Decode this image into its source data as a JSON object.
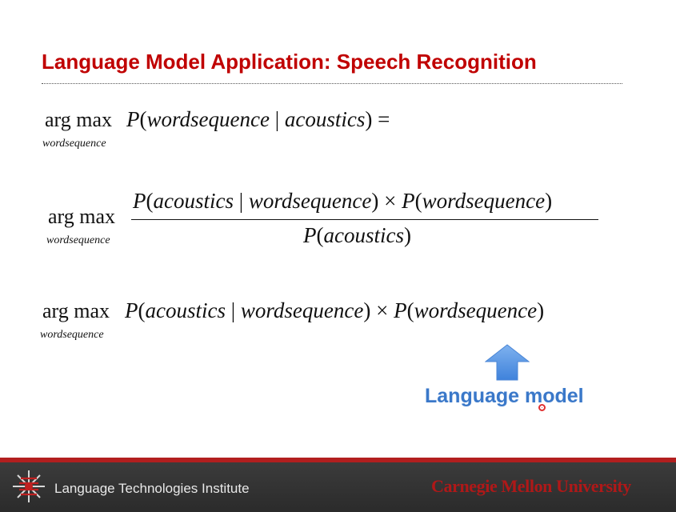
{
  "slide": {
    "title": "Language Model Application: Speech Recognition",
    "eq1": {
      "argmax": "arg max",
      "subscript": "wordsequence",
      "expression_prefix": "P(",
      "expression_body": "wordsequence | acoustics",
      "expression_suffix": ") ="
    },
    "eq2": {
      "argmax": "arg max",
      "subscript": "wordsequence",
      "numerator": "P(acoustics | wordsequence) × P(wordsequence)",
      "denominator": "P(acoustics)"
    },
    "eq3": {
      "argmax": "arg max",
      "subscript": "wordsequence",
      "expression": "P(acoustics | wordsequence) × P(wordsequence)"
    },
    "annotation": {
      "arrow_icon": "up-arrow-icon",
      "label": "Language model",
      "arrow_color": "#4a8ee0",
      "label_color": "#3a78c9"
    }
  },
  "footer": {
    "institute": "Language Technologies Institute",
    "university": "Carnegie Mellon University",
    "stripe_color": "#b21f1f",
    "background_color": "#333333"
  },
  "colors": {
    "title": "#c00000"
  }
}
